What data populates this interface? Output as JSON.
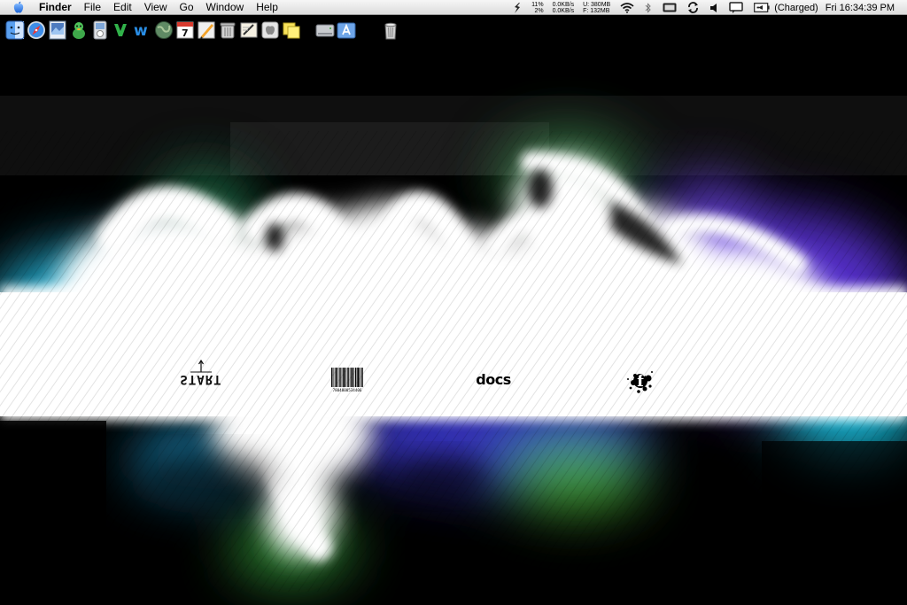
{
  "menubar": {
    "app_name": "Finder",
    "menus": [
      "File",
      "Edit",
      "View",
      "Go",
      "Window",
      "Help"
    ],
    "cpu": {
      "line1": "11%",
      "line2": "2%"
    },
    "network": {
      "line1": "0.0KB/s",
      "line2": "0.0KB/s"
    },
    "memory": {
      "line1": "U:  380MB",
      "line2": "F:  132MB"
    },
    "battery_status": "(Charged)",
    "clock": "Fri 16:34:39 PM"
  },
  "dock": {
    "icons": [
      "finder-icon",
      "safari-icon",
      "preview-icon",
      "adium-icon",
      "itunes-icon",
      "dreamweaver-icon",
      "word-icon",
      "globe-icon",
      "ical-icon",
      "pencil-app-icon",
      "trash-can-icon",
      "textedit-icon",
      "apple-app-icon",
      "stickies-icon",
      "hard-drive-icon",
      "applications-folder-icon",
      "trash-icon"
    ]
  },
  "desktop": {
    "start_label": "START",
    "docs_label": "docs",
    "barcode_digits": "7804000534406",
    "logo_glyph": "f"
  },
  "colors": {
    "menubar_bg": "#e8e8e8",
    "glow_cyan": "#29d3ff",
    "glow_violet": "#6a3cff",
    "glow_green": "#4fbf3a"
  }
}
